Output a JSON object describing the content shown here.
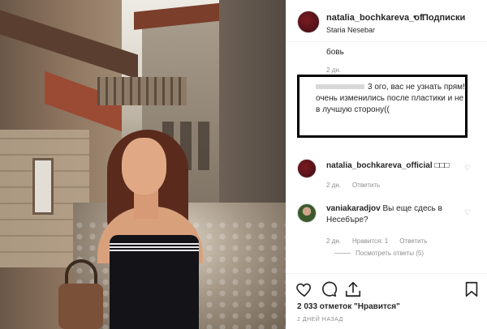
{
  "post": {
    "username": "natalia_bochkareva_of",
    "dot": "•",
    "follow_label": "Подписки",
    "location": "Staria Nesebar"
  },
  "comments": {
    "fragment_top": "бовь",
    "fragment_meta": "2 дн.",
    "censored": {
      "left_mark": "",
      "text": "3 ого, вас не узнать прям! очень изменились после пластики и не в лучшую сторону(("
    },
    "items": [
      {
        "user": "natalia_bochkareva_official",
        "text": " □□□",
        "meta_time": "2 дн.",
        "meta_likes": "",
        "meta_reply": "Ответить"
      },
      {
        "user": "vaniakaradjov",
        "text": " Вы еще сдесь в Несебъре?",
        "meta_time": "2 дн.",
        "meta_likes": "Нравится: 1",
        "meta_reply": "Ответить"
      }
    ],
    "view_replies": "Посмотреть ответы (5)"
  },
  "actions": {
    "like_icon": "heart-icon",
    "comment_icon": "comment-icon",
    "share_icon": "share-icon",
    "save_icon": "bookmark-icon"
  },
  "likes_text": "2 033 отметок \"Нравится\"",
  "timestamp": "2 ДНЕЙ НАЗАД"
}
